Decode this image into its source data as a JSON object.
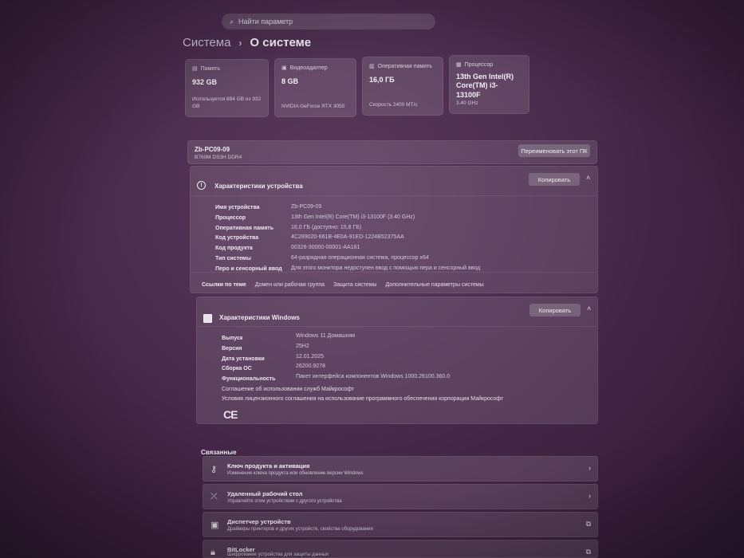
{
  "search": {
    "placeholder": "Найти параметр",
    "icon": "search-icon"
  },
  "breadcrumb": {
    "root": "Система",
    "separator": "›",
    "current": "О системе"
  },
  "tiles": [
    {
      "label": "Память",
      "value": "932 GB",
      "sub": "Используется 894 GB из 932 GB"
    },
    {
      "label": "Видеоадаптер",
      "value": "8 GB",
      "sub": "NVIDIA GeForce RTX 3050"
    },
    {
      "label": "Оперативная память",
      "value": "16,0 ГБ",
      "sub": "Скорость 2400 МТ/с"
    },
    {
      "label": "Процессор",
      "value": "13th Gen Intel(R) Core(TM) i3-13100F",
      "sub": "3.40 GHz"
    }
  ],
  "pc": {
    "name": "Zb-PC09-09",
    "board": "B760M DS3H DDR4",
    "rename_label": "Переименовать этот ПК"
  },
  "device": {
    "title": "Характеристики устройства",
    "copy_label": "Копировать",
    "rows": [
      {
        "k": "Имя устройства",
        "v": "Zb-PC09-09"
      },
      {
        "k": "Процессор",
        "v": "13th Gen Intel(R) Core(TM) i3-13100F (3.40 GHz)"
      },
      {
        "k": "Оперативная память",
        "v": "16,0 ГБ (доступно: 15,8 ГБ)"
      },
      {
        "k": "Код устройства",
        "v": "4C289020-661B-4E0A-91ED-1224B52375AA"
      },
      {
        "k": "Код продукта",
        "v": "00326-30000-00001-AA161"
      },
      {
        "k": "Тип системы",
        "v": "64-разрядная операционная система, процессор x64"
      },
      {
        "k": "Перо и сенсорный ввод",
        "v": "Для этого монитора недоступен ввод с помощью пера и сенсорный ввод"
      }
    ],
    "links_label": "Ссылки по теме",
    "links": [
      "Домен или рабочая группа",
      "Защита системы",
      "Дополнительные параметры системы"
    ]
  },
  "windows": {
    "title": "Характеристики Windows",
    "copy_label": "Копировать",
    "rows": [
      {
        "k": "Выпуск",
        "v": "Windows 11 Домашняя"
      },
      {
        "k": "Версия",
        "v": "25H2"
      },
      {
        "k": "Дата установки",
        "v": "12.01.2025"
      },
      {
        "k": "Сборка ОС",
        "v": "26200.9278"
      },
      {
        "k": "Функциональность",
        "v": "Пакет интерфейса компонентов Windows 1000.26100.360.0"
      }
    ],
    "agreement1": "Соглашение об использовании служб Майкрософт",
    "agreement2": "Условия лицензионного соглашения на использование программного обеспечения корпорации Майкрософт",
    "ce_mark": "CE"
  },
  "related": {
    "label": "Связанные",
    "items": [
      {
        "title": "Ключ продукта и активация",
        "desc": "Изменение ключа продукта или обновление версии Windows",
        "icon": "key-icon",
        "arrow": "›"
      },
      {
        "title": "Удаленный рабочий стол",
        "desc": "Управляйте этим устройством с другого устройства",
        "icon": "remote-desktop-icon",
        "arrow": "›"
      },
      {
        "title": "Диспетчер устройств",
        "desc": "Драйверы принтеров и других устройств, свойства оборудования",
        "icon": "device-manager-icon",
        "arrow": "⧉"
      },
      {
        "title": "BitLocker",
        "desc": "Шифрование устройства для защиты данных",
        "icon": "lock-icon",
        "arrow": "⧉"
      }
    ]
  }
}
